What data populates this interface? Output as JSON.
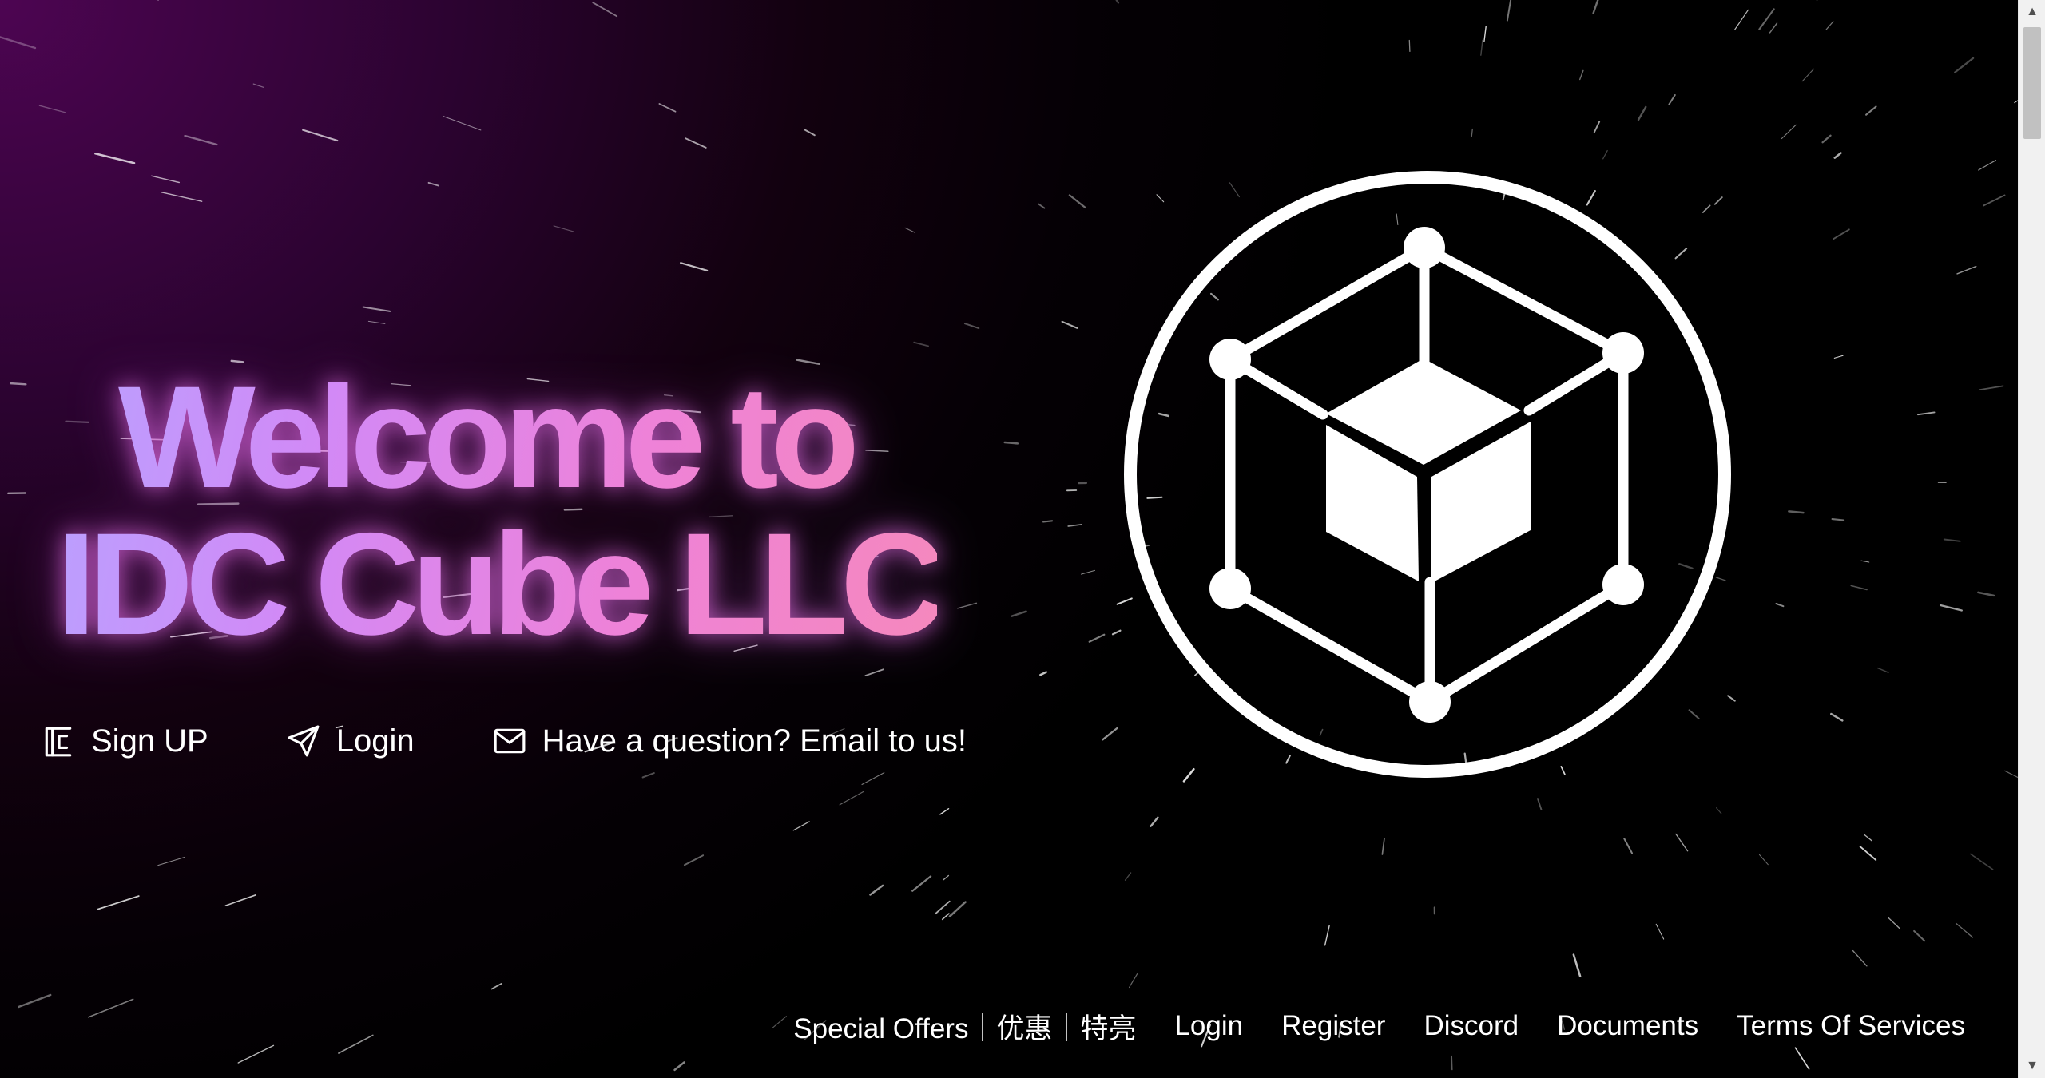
{
  "hero": {
    "title_line1": "Welcome to",
    "title_line2": "IDC Cube LLC"
  },
  "actions": {
    "signup_label": "Sign UP",
    "login_label": "Login",
    "email_label": "Have a question? Email to us!"
  },
  "footer": {
    "links": [
      "Special Offers｜优惠｜特亮",
      "Login",
      "Register",
      "Discord",
      "Documents",
      "Terms Of Services"
    ]
  },
  "icons": {
    "signup": "signup-icon",
    "login": "paper-plane-icon",
    "email": "envelope-icon",
    "logo": "cube-logo-icon",
    "scroll_up": "scroll-up-arrow-icon",
    "scroll_down": "scroll-down-arrow-icon"
  },
  "colors": {
    "background_dark": "#000000",
    "background_purple": "#4d0552",
    "title_gradient_start": "#b9a1ff",
    "title_gradient_mid": "#d289f6",
    "title_gradient_end": "#f588bd",
    "text": "#ffffff"
  }
}
